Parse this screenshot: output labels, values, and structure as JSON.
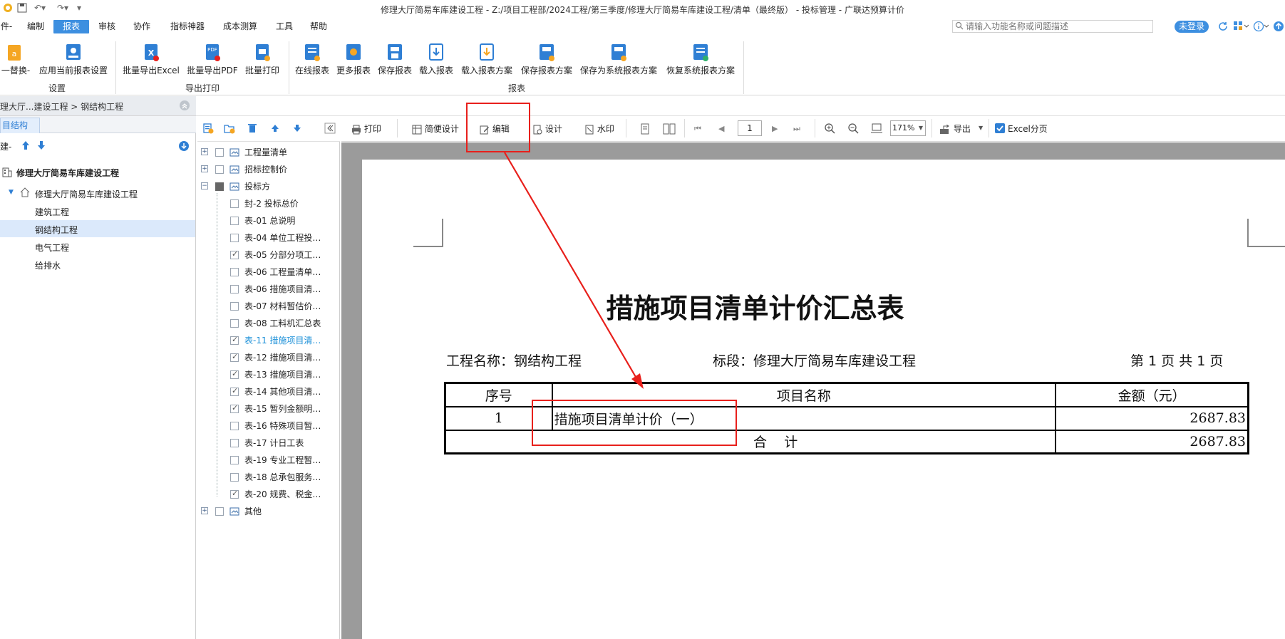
{
  "window": {
    "title": "修理大厅简易车库建设工程 - Z:/项目工程部/2024工程/第三季度/修理大厅简易车库建设工程/清单（最终版） - 投标管理 - 广联达预算计价"
  },
  "menu": {
    "items": [
      "件-",
      "编制",
      "报表",
      "审核",
      "协作",
      "指标神器",
      "成本测算",
      "工具",
      "帮助"
    ],
    "active": "报表"
  },
  "search": {
    "placeholder": "请输入功能名称或问题描述"
  },
  "login_label": "未登录",
  "ribbon": {
    "groups": [
      {
        "label": "设置",
        "buttons": [
          "一替换-",
          "应用当前报表设置"
        ]
      },
      {
        "label": "导出打印",
        "buttons": [
          "批量导出Excel",
          "批量导出PDF",
          "批量打印"
        ]
      },
      {
        "label": "报表",
        "buttons": [
          "在线报表",
          "更多报表",
          "保存报表",
          "载入报表",
          "载入报表方案",
          "保存报表方案",
          "保存为系统报表方案",
          "恢复系统报表方案"
        ]
      }
    ]
  },
  "breadcrumb": {
    "text": "理大厅...建设工程 > 钢结构工程"
  },
  "left_panel": {
    "tab": "目结构",
    "new_label": "建-",
    "tree": {
      "root": "修理大厅简易车库建设工程",
      "child": "修理大厅简易车库建设工程",
      "items": [
        "建筑工程",
        "钢结构工程",
        "电气工程",
        "给排水"
      ],
      "selected": "钢结构工程"
    }
  },
  "report_tree": {
    "groups": [
      {
        "label": "工程量清单",
        "expanded": false
      },
      {
        "label": "招标控制价",
        "expanded": false
      },
      {
        "label": "投标方",
        "expanded": true
      },
      {
        "label": "其他",
        "expanded": false
      }
    ],
    "items": [
      {
        "label": "封-2 投标总价",
        "checked": false
      },
      {
        "label": "表-01 总说明",
        "checked": false
      },
      {
        "label": "表-04 单位工程投…",
        "checked": false
      },
      {
        "label": "表-05 分部分项工…",
        "checked": true
      },
      {
        "label": "表-06 工程量清单…",
        "checked": false
      },
      {
        "label": "表-06 措施项目清…",
        "checked": false
      },
      {
        "label": "表-07 材料暂估价…",
        "checked": false
      },
      {
        "label": "表-08 工料机汇总表",
        "checked": false
      },
      {
        "label": "表-11 措施项目清…",
        "checked": true,
        "highlight": true
      },
      {
        "label": "表-12 措施项目清…",
        "checked": true
      },
      {
        "label": "表-13 措施项目清…",
        "checked": true
      },
      {
        "label": "表-14 其他项目清…",
        "checked": true
      },
      {
        "label": "表-15 暂列金额明…",
        "checked": true
      },
      {
        "label": "表-16 特殊项目暂…",
        "checked": false
      },
      {
        "label": "表-17 计日工表",
        "checked": false
      },
      {
        "label": "表-19 专业工程暂…",
        "checked": false
      },
      {
        "label": "表-18 总承包服务…",
        "checked": false
      },
      {
        "label": "表-20 规费、税金…",
        "checked": true
      }
    ]
  },
  "viewer_toolbar": {
    "print": "打印",
    "simple_design": "简便设计",
    "edit": "编辑",
    "design": "设计",
    "watermark": "水印",
    "page": "1",
    "zoom": "171%",
    "export": "导出",
    "excel_paging": "Excel分页",
    "excel_paging_checked": true
  },
  "report": {
    "title": "措施项目清单计价汇总表",
    "project_name": "工程名称：钢结构工程",
    "section": "标段：修理大厅简易车库建设工程",
    "page_info": "第 1 页  共 1 页",
    "headers": [
      "序号",
      "项目名称",
      "金额（元）"
    ],
    "rows": [
      {
        "no": "1",
        "name": "措施项目清单计价（一）",
        "amount": "2687.83"
      }
    ],
    "total_label": "合    计",
    "total_amount": "2687.83"
  },
  "colors": {
    "accent": "#3d8fe0",
    "annotation": "#e8201c",
    "viewer_bg": "#9b9b9b"
  }
}
